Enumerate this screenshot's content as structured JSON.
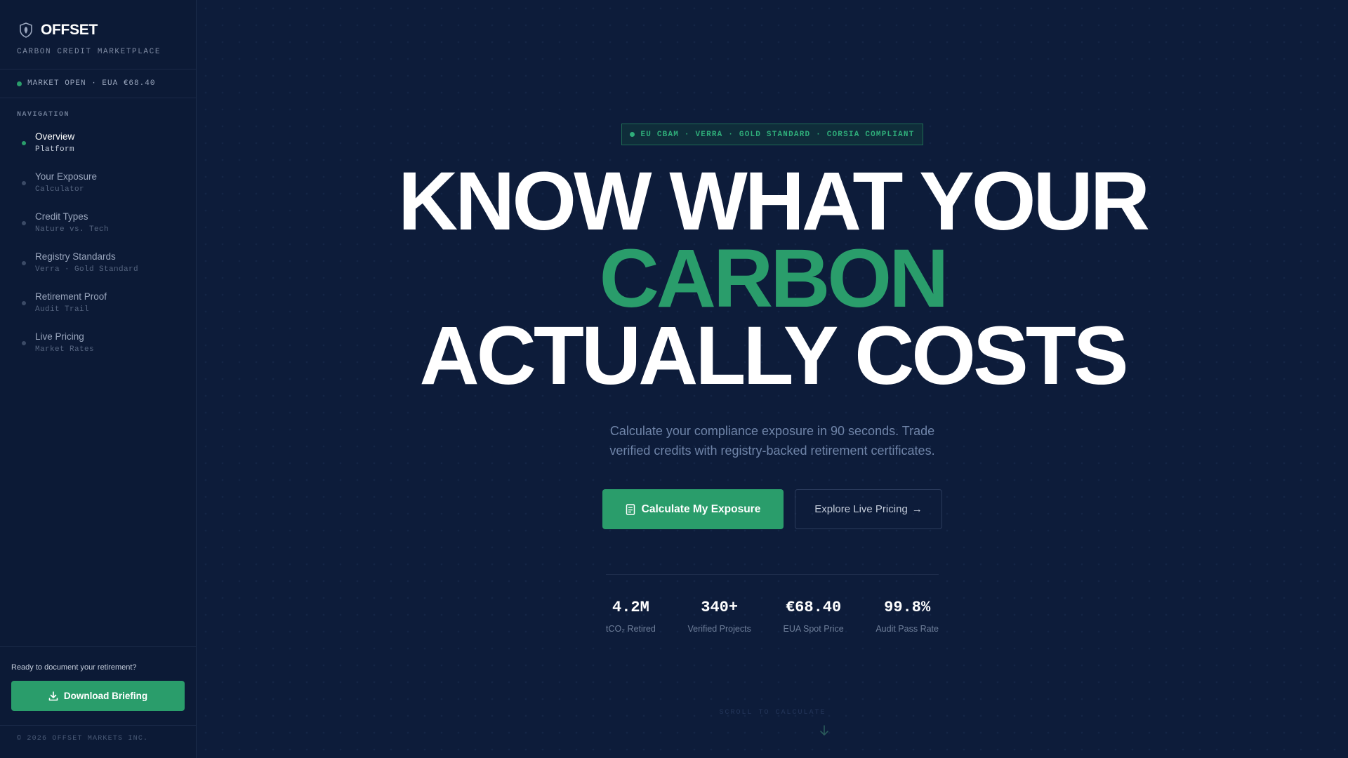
{
  "brand": {
    "name": "OFFSET",
    "tagline": "CARBON CREDIT MARKETPLACE",
    "icon": "shield-leaf-icon"
  },
  "market_status": "MARKET OPEN · EUA €68.40",
  "navigation": {
    "heading": "NAVIGATION",
    "items": [
      {
        "title": "Overview",
        "subtitle": "Platform",
        "active": true
      },
      {
        "title": "Your Exposure",
        "subtitle": "Calculator",
        "active": false
      },
      {
        "title": "Credit Types",
        "subtitle": "Nature vs. Tech",
        "active": false
      },
      {
        "title": "Registry Standards",
        "subtitle": "Verra · Gold Standard",
        "active": false
      },
      {
        "title": "Retirement Proof",
        "subtitle": "Audit Trail",
        "active": false
      },
      {
        "title": "Live Pricing",
        "subtitle": "Market Rates",
        "active": false
      }
    ]
  },
  "sidebar_footer": {
    "prompt": "Ready to document your retirement?",
    "button_label": "Download Briefing",
    "copyright": "© 2026 OFFSET MARKETS INC."
  },
  "hero": {
    "badge": "EU CBAM · VERRA · GOLD STANDARD · CORSIA COMPLIANT",
    "headline_line1": "KNOW WHAT YOUR",
    "headline_line2": "CARBON",
    "headline_line3": "ACTUALLY COSTS",
    "subtitle": "Calculate your compliance exposure in 90 seconds. Trade verified credits with registry-backed retirement certificates.",
    "primary_button": "Calculate My Exposure",
    "secondary_button": "Explore Live Pricing",
    "secondary_arrow": "→"
  },
  "stats": [
    {
      "value": "4.2M",
      "label": "tCO₂ Retired"
    },
    {
      "value": "340+",
      "label": "Verified Projects"
    },
    {
      "value": "€68.40",
      "label": "EUA Spot Price"
    },
    {
      "value": "99.8%",
      "label": "Audit Pass Rate"
    }
  ],
  "scroll_hint": "SCROLL TO CALCULATE",
  "colors": {
    "background": "#0d1b38",
    "accent": "#2a9d6b",
    "text_muted": "#6f84a8"
  }
}
